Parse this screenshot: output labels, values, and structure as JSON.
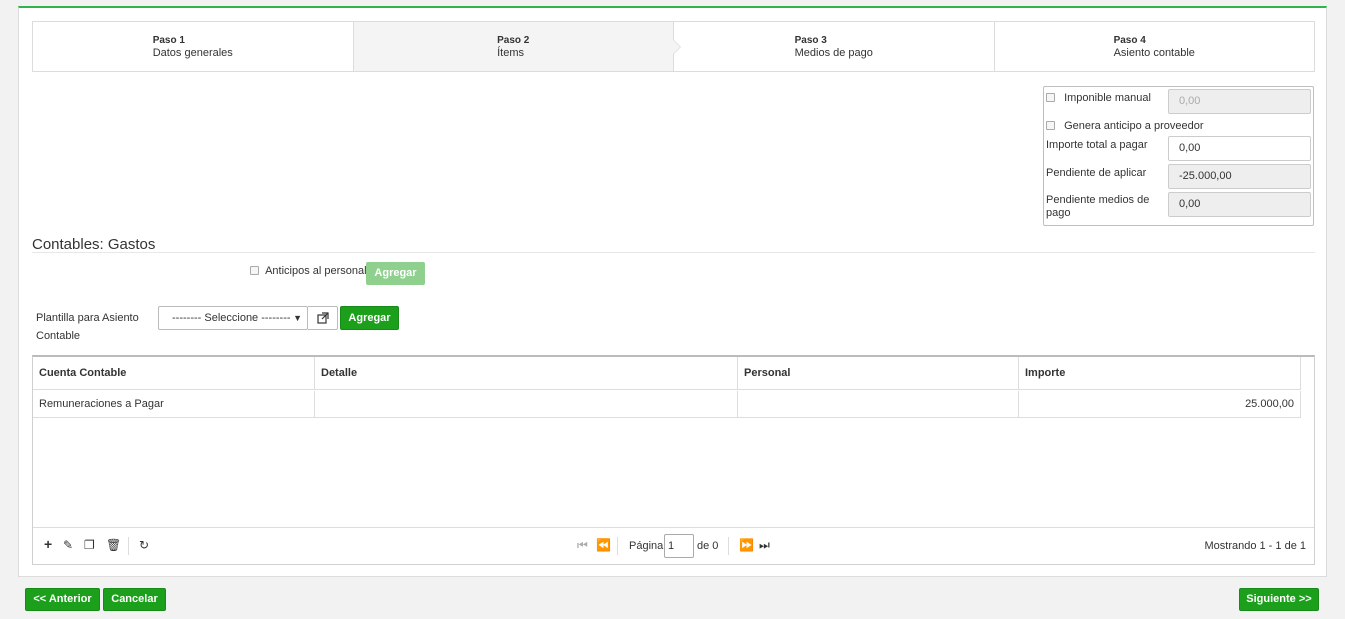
{
  "wizard": {
    "steps": [
      {
        "num": "Paso 1",
        "label": "Datos generales"
      },
      {
        "num": "Paso 2",
        "label": "Ítems"
      },
      {
        "num": "Paso 3",
        "label": "Medios de pago"
      },
      {
        "num": "Paso 4",
        "label": "Asiento contable"
      }
    ]
  },
  "summary": {
    "imponible_manual_label": "Imponible manual",
    "imponible_manual_placeholder": "0,00",
    "genera_anticipo_label": "Genera anticipo a proveedor",
    "importe_total_label": "Importe total a pagar",
    "importe_total_value": "0,00",
    "pendiente_aplicar_label": "Pendiente de aplicar",
    "pendiente_aplicar_value": "-25.000,00",
    "pendiente_medios_label": "Pendiente medios de pago",
    "pendiente_medios_value": "0,00"
  },
  "section": {
    "title": "Contables: Gastos",
    "anticipos_label": "Anticipos al personal",
    "agregar_label": "Agregar",
    "plantilla_label": "Plantilla para Asiento Contable",
    "select_value": "-------- Seleccione --------",
    "agregar2_label": "Agregar"
  },
  "grid": {
    "headers": [
      "Cuenta Contable",
      "Detalle",
      "Personal",
      "Importe"
    ],
    "rows": [
      [
        "Remuneraciones a Pagar",
        "",
        "",
        "25.000,00"
      ]
    ],
    "pager": {
      "page_label": "Página",
      "page_value": "1",
      "of_label": "de 0",
      "showing": "Mostrando 1 - 1 de 1"
    }
  },
  "footer": {
    "prev_label": "<< Anterior",
    "cancel_label": "Cancelar",
    "next_label": "Siguiente >>"
  },
  "colors": {
    "accent": "#1ca01c",
    "top_border": "#2fb34a"
  }
}
